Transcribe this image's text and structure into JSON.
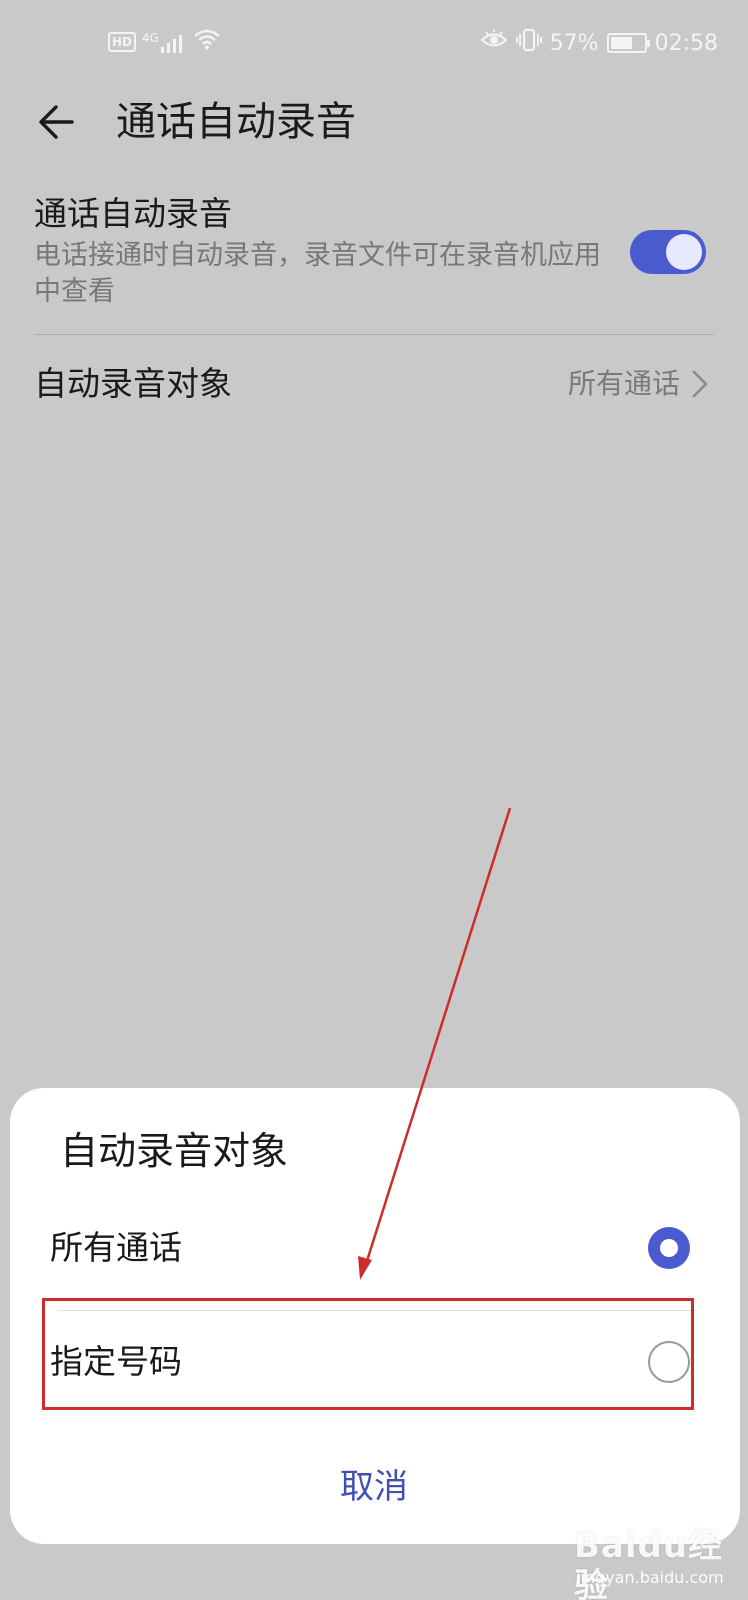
{
  "status_bar": {
    "hd_badge": "HD",
    "network_label": "4G",
    "battery_percent": "57%",
    "battery_level": 0.57,
    "time": "02:58",
    "icons": [
      "signal-icon",
      "wifi-icon",
      "eye-comfort-icon",
      "vibrate-icon",
      "battery-icon"
    ]
  },
  "app_bar": {
    "title": "通话自动录音",
    "back_icon": "arrow-left-icon"
  },
  "settings": {
    "auto_record": {
      "title": "通话自动录音",
      "description": "电话接通时自动录音，录音文件可在录音机应用中查看",
      "enabled": true
    },
    "record_target": {
      "title": "自动录音对象",
      "value": "所有通话"
    }
  },
  "dialog": {
    "title": "自动录音对象",
    "options": [
      {
        "label": "所有通话",
        "selected": true
      },
      {
        "label": "指定号码",
        "selected": false
      }
    ],
    "cancel_label": "取消"
  },
  "colors": {
    "accent": "#4a5bd0",
    "cancel_text": "#3f51b5",
    "annotation_red": "#cf2b2b",
    "background_dim": "#c9c9c9"
  },
  "watermark": {
    "logo_text": "Baidu经验",
    "url": "jingyan.baidu.com"
  }
}
